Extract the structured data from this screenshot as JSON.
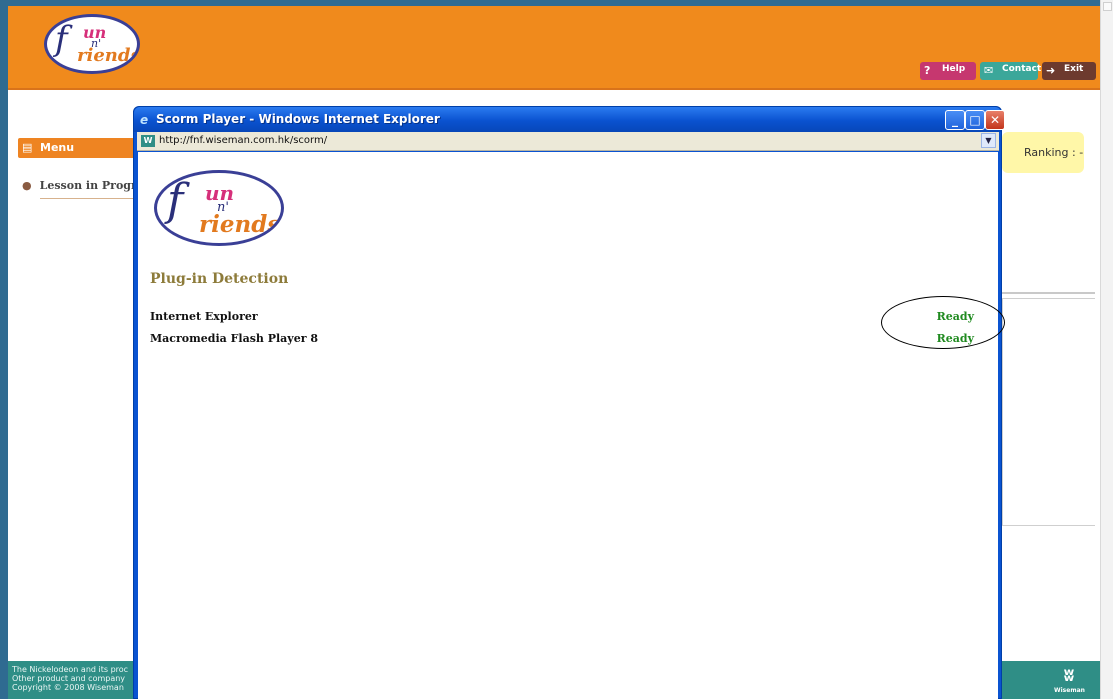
{
  "app": {
    "logo": {
      "f": "f",
      "un": "un",
      "n": "n'",
      "riends": "riends"
    }
  },
  "header": {
    "buttons": {
      "help": "Help",
      "contact": "Contact",
      "exit": "Exit"
    },
    "brand_color": "#f08a1c"
  },
  "sidebar": {
    "menu_label": "Menu",
    "lesson_label": "Lesson in Progre"
  },
  "ranking": {
    "label": "Ranking : -"
  },
  "footer": {
    "legal": "The Nickelodeon and its proc\nOther product and company\nCopyright © 2008 Wiseman",
    "brand": "Wiseman",
    "color": "#2f8e86"
  },
  "popup": {
    "title": "Scorm Player - Windows Internet Explorer",
    "url": "http://fnf.wiseman.com.hk/scorm/",
    "heading": "Plug-in Detection",
    "plugins": [
      {
        "name": "Internet Explorer",
        "status": "Ready"
      },
      {
        "name": "Macromedia Flash Player 8",
        "status": "Ready"
      }
    ],
    "status_color": "#1f8a1f",
    "titlebar_color": "#0a53d1"
  }
}
